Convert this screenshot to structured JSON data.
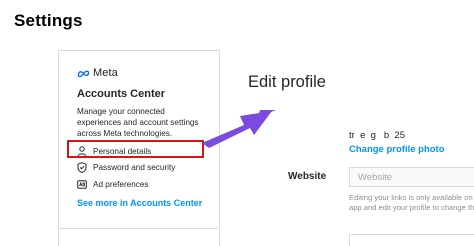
{
  "header": {
    "title": "Settings"
  },
  "sidebar": {
    "brand": "Meta",
    "section_title": "Accounts Center",
    "description": "Manage your connected experiences and account settings across Meta technologies.",
    "items": [
      {
        "label": "Personal details",
        "icon": "person-icon",
        "highlighted": true
      },
      {
        "label": "Password and security",
        "icon": "shield-icon",
        "highlighted": false
      },
      {
        "label": "Ad preferences",
        "icon": "ad-icon",
        "highlighted": false
      }
    ],
    "see_more": "See more in Accounts Center"
  },
  "main": {
    "title": "Edit profile",
    "username": "tr  e  g   b  25",
    "change_photo": "Change profile photo",
    "website_label": "Website",
    "website_placeholder": "Website",
    "helper_text_lines": [
      "Editing your links is only available on",
      "app and edit your profile to change the"
    ]
  },
  "colors": {
    "accent_blue": "#0095f6",
    "highlight_red": "#e0101a",
    "arrow_purple": "#7b4be0"
  }
}
